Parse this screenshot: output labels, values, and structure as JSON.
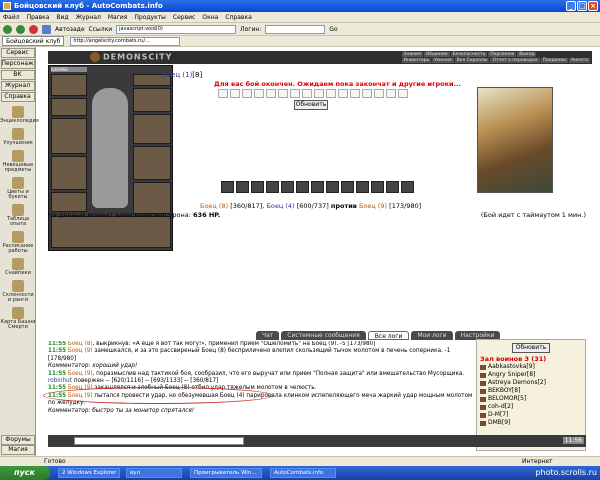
{
  "window": {
    "title": "Бойцовский клуб - AutoCombats.info"
  },
  "menu": [
    "Файл",
    "Правка",
    "Вид",
    "Журнал",
    "Магия",
    "Продукты",
    "Сервис",
    "Окна",
    "Справка"
  ],
  "toolbar": {
    "autofill": "Автозаде",
    "links": "Ссылки",
    "login": "Логин:",
    "go": "Go"
  },
  "address": {
    "tab": "Бойцовский клуб",
    "url": "http://angelscity.combats.ru/...",
    "js": "javascript:void(0)"
  },
  "sidebar": {
    "tabs": [
      "Сервис",
      "Персонаж",
      "ВК",
      "Журнал",
      "Справка"
    ],
    "items": [
      "Энциклопедия",
      "Улучшения",
      "Невещевые предметы",
      "Цветы и букеты",
      "Таблица опыта",
      "Расписание работы",
      "Снайпики",
      "Склонности и ранги",
      "Карта Башни Смерти"
    ],
    "bottom": [
      "Форумы",
      "Магия"
    ]
  },
  "game": {
    "logo": "DEMONSCITY",
    "nav_row1": [
      "Знания",
      "Общение",
      "Безопасность",
      "Персонаж",
      "Выход"
    ],
    "nav_row2": [
      "Инвентарь",
      "Умения",
      "Вкл Скроллы",
      "Отчет о переводах",
      "Поединки",
      "Анкета"
    ],
    "hp": "636/960",
    "fighter": {
      "name": "Боец (1)",
      "suffix": "[8]"
    },
    "warning": "Для вас бой окончен. Ожидаем пока закончат и другие игроки...",
    "refresh": "Обновить",
    "fight": {
      "left": "Боец (8)",
      "left_hp": "[360/817],",
      "mid": "Боец (4)",
      "mid_hp": "[600/737]",
      "vs": "против",
      "right": "Боец (9)",
      "right_hp": "[173/980]"
    },
    "damage_label": "На данный момент вами нанесено урона:",
    "damage_value": "636 HP.",
    "timeout_text": "(Бой идет с таймаутом 1 мин.)"
  },
  "chat": {
    "tabs": [
      "Чат",
      "Системные сообщения",
      "Все логи",
      "Мои логи",
      "Настройки"
    ],
    "active_tab": "Все логи",
    "lines": [
      {
        "time": "11:55",
        "user": "Боец (8)",
        "cls": "u1",
        "text": ", выкрикнув: «А ещё я вот так могу!», применил прием \"Ошеломить\" на Боец (9). -5 [173/980]"
      },
      {
        "time": "11:55",
        "user": "Боец (9)",
        "cls": "u1",
        "text": " замешкался, и за это рассвиреный Боец (8) бесприличено влепил скользящий тычок молотом в печень соперника. -1 [178/980]"
      },
      {
        "time": "",
        "user": "",
        "cls": "c",
        "text": "Комментатор: хороший удар!"
      },
      {
        "time": "11:55",
        "user": "Боец (9)",
        "cls": "u1",
        "text": ", поразмыслив над тактикой боя, сообразил, что его выручат или прием \"Полная защита\" или вмешательство Мусорщика."
      },
      {
        "time": "",
        "user": "robinhut",
        "cls": "u2",
        "text": " повержен -- [620/1116] -- [693/1133] -- [360/817]"
      },
      {
        "time": "11:55",
        "user": "Боец (9)",
        "cls": "u1",
        "text": " закашлялся и злобный Боец (8) отбил удар тяжелым молотом в челюсть."
      },
      {
        "time": "11:55",
        "user": "Боец (9)",
        "cls": "u1",
        "text": " пытался провести удар, но обезумевшая Боец (4) парировала клинком испепеляющего меча жаркий удар мощным молотом по желудку."
      },
      {
        "time": "",
        "user": "",
        "cls": "c",
        "text": "Комментатор: быстро ты за монитор спрятался!"
      }
    ]
  },
  "players": {
    "refresh": "Обновить",
    "title": "Зал воинов 3 (31)",
    "list": [
      "Aabkastovka[9]",
      "Angry Sniper[8]",
      "Astreya Demons[2]",
      "BEKBOY[8]",
      "BELOMOR[5]",
      "coh-d[2]",
      "D-M[7]",
      "DMB[9]"
    ]
  },
  "clock": "11:56",
  "status": {
    "left": "Готово",
    "right": "Интернет"
  },
  "taskbar": {
    "start": "пуск",
    "tasks": [
      "2 Windows Explorer",
      "вул",
      "Проигрыватель Win...",
      "AutoCombats.info"
    ]
  },
  "watermark": "photo.scrolls.ru"
}
